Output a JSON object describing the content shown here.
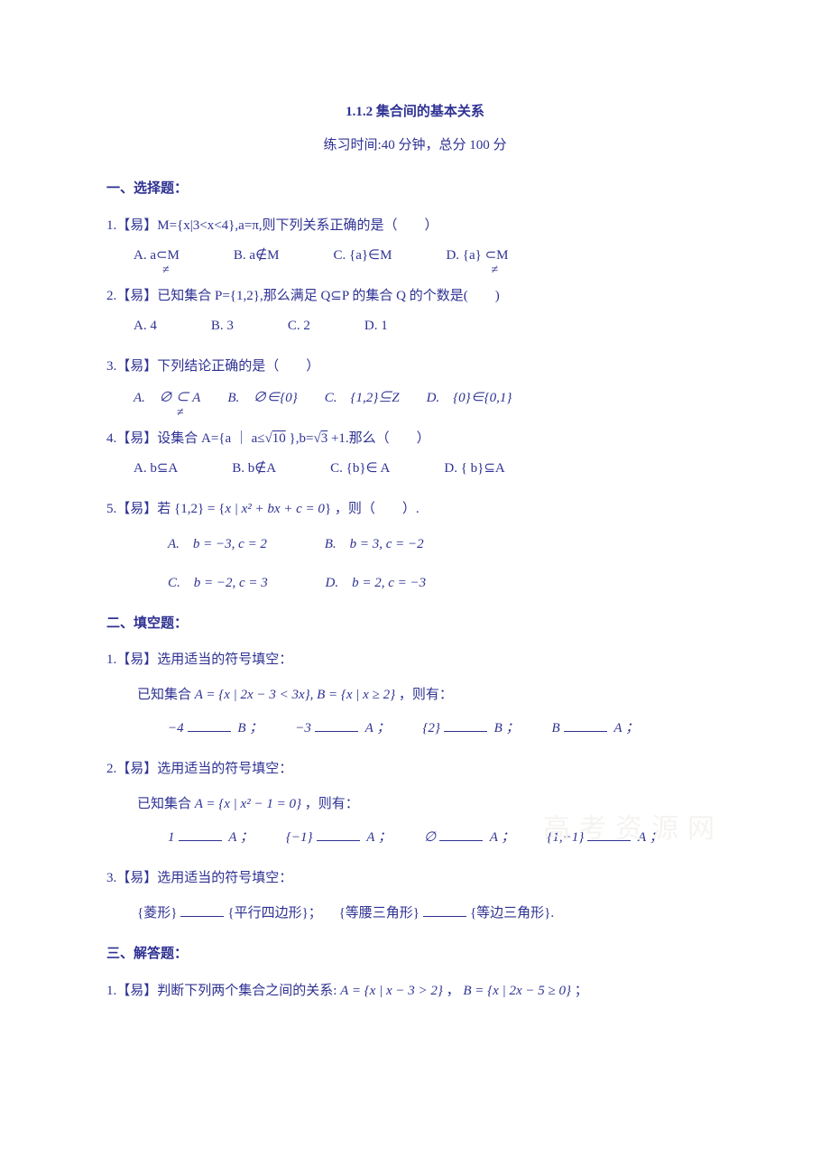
{
  "header": {
    "title": "1.1.2 集合间的基本关系",
    "subtitle": "练习时间:40 分钟，总分 100 分"
  },
  "sections": {
    "s1": "一、选择题：",
    "s2": "二、填空题：",
    "s3": "三、解答题："
  },
  "mc": {
    "q1": {
      "stem": "1.【易】M={x|3<x<4},a=π,则下列关系正确的是（　　）",
      "A": "A. a⊂M",
      "Aslash": "≠",
      "B": "B. a∉M",
      "C": "C. {a}∈M",
      "D": "D. {a} ⊂M",
      "Dslash": "≠"
    },
    "q2": {
      "stem": "2.【易】已知集合 P={1,2},那么满足 Q⊆P 的集合 Q 的个数是(　　)",
      "A": "A. 4",
      "B": "B. 3",
      "C": "C. 2",
      "D": "D. 1"
    },
    "q3": {
      "stem": "3.【易】下列结论正确的是（　　）",
      "A": "A.　∅ ⊂ A",
      "Aslash": "≠",
      "B": "B.　∅∈{0}",
      "C": "C.　{1,2}⊆Z",
      "D": "D.　{0}∈{0,1}"
    },
    "q4": {
      "stem_pre": "4.【易】设集合 A={a ｜ a≤",
      "root10": "10",
      "stem_mid": " },b=",
      "root3": "3",
      "stem_post": " +1.那么（　　）",
      "A": "A. b⊆A",
      "B": "B. b∉A",
      "C": "C. {b}∈ A",
      "D": "D. { b}⊆A"
    },
    "q5": {
      "stem_pre": "5.【易】若 {1,2} = {",
      "stem_math": "x | x² + bx + c = 0",
      "stem_post": "} ，则（　　）.",
      "A": "A.　b = −3,  c = 2",
      "B": "B.　b = 3,  c = −2",
      "C": "C.　b = −2,  c = 3",
      "D": "D.　b = 2,  c = −3"
    }
  },
  "fb": {
    "q1": {
      "stem": "1.【易】选用适当的符号填空：",
      "line1_pre": "已知集合 ",
      "line1_math": "A = {x | 2x − 3 < 3x}, B = {x | x ≥ 2}",
      "line1_post": " ，则有：",
      "b1a": "−4",
      "b1b": "B ；",
      "b2a": "−3",
      "b2b": "A ；",
      "b3a": "{2}",
      "b3b": "B ；",
      "b4a": "B",
      "b4b": "A ；"
    },
    "q2": {
      "stem": "2.【易】选用适当的符号填空：",
      "line1_pre": "已知集合 ",
      "line1_math": "A = {x | x² − 1 = 0}",
      "line1_post": " ，则有：",
      "b1a": "1",
      "b1b": "A ；",
      "b2a": "{−1}",
      "b2b": "A ；",
      "b3a": "∅",
      "b3b": "A ；",
      "b4a": "{1,−1}",
      "b4b": "A ；"
    },
    "q3": {
      "stem": "3.【易】选用适当的符号填空：",
      "t1": "{菱形}",
      "t2": "{平行四边形}；",
      "t3": "{等腰三角形}",
      "t4": "{等边三角形}."
    }
  },
  "sa": {
    "q1": {
      "stem_pre": "1.【易】判断下列两个集合之间的关系: ",
      "math1": "A = {x | x − 3 > 2}",
      "mid": " ， ",
      "math2": "B = {x | 2x − 5 ≥ 0}",
      "post": " ；"
    }
  },
  "watermark": "高考资源网"
}
